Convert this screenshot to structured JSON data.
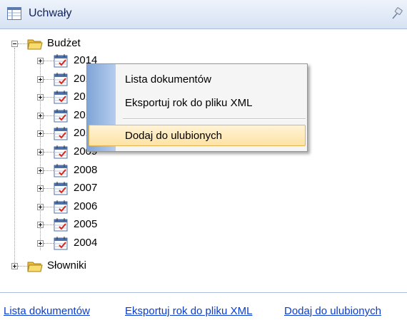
{
  "header": {
    "title": "Uchwały",
    "icon": "table-icon",
    "pin_icon": "pin-icon"
  },
  "tree": {
    "budzet": {
      "label": "Budżet",
      "children": [
        "2014",
        "2013",
        "2012",
        "2011",
        "2010",
        "2009",
        "2008",
        "2007",
        "2006",
        "2005",
        "2004"
      ]
    },
    "slowniki": {
      "label": "Słowniki"
    }
  },
  "context_menu": {
    "items": [
      "Lista dokumentów",
      "Eksportuj rok do pliku XML",
      "Dodaj do ulubionych"
    ],
    "highlighted": "Dodaj do ulubionych"
  },
  "bottom_links": [
    "Lista dokumentów",
    "Eksportuj rok do pliku XML",
    "Dodaj do ulubionych"
  ],
  "colors": {
    "header_title": "#10245a",
    "link": "#0a3ccf",
    "highlight_border": "#e6b451",
    "menu_strip": "#7fa4d6"
  }
}
